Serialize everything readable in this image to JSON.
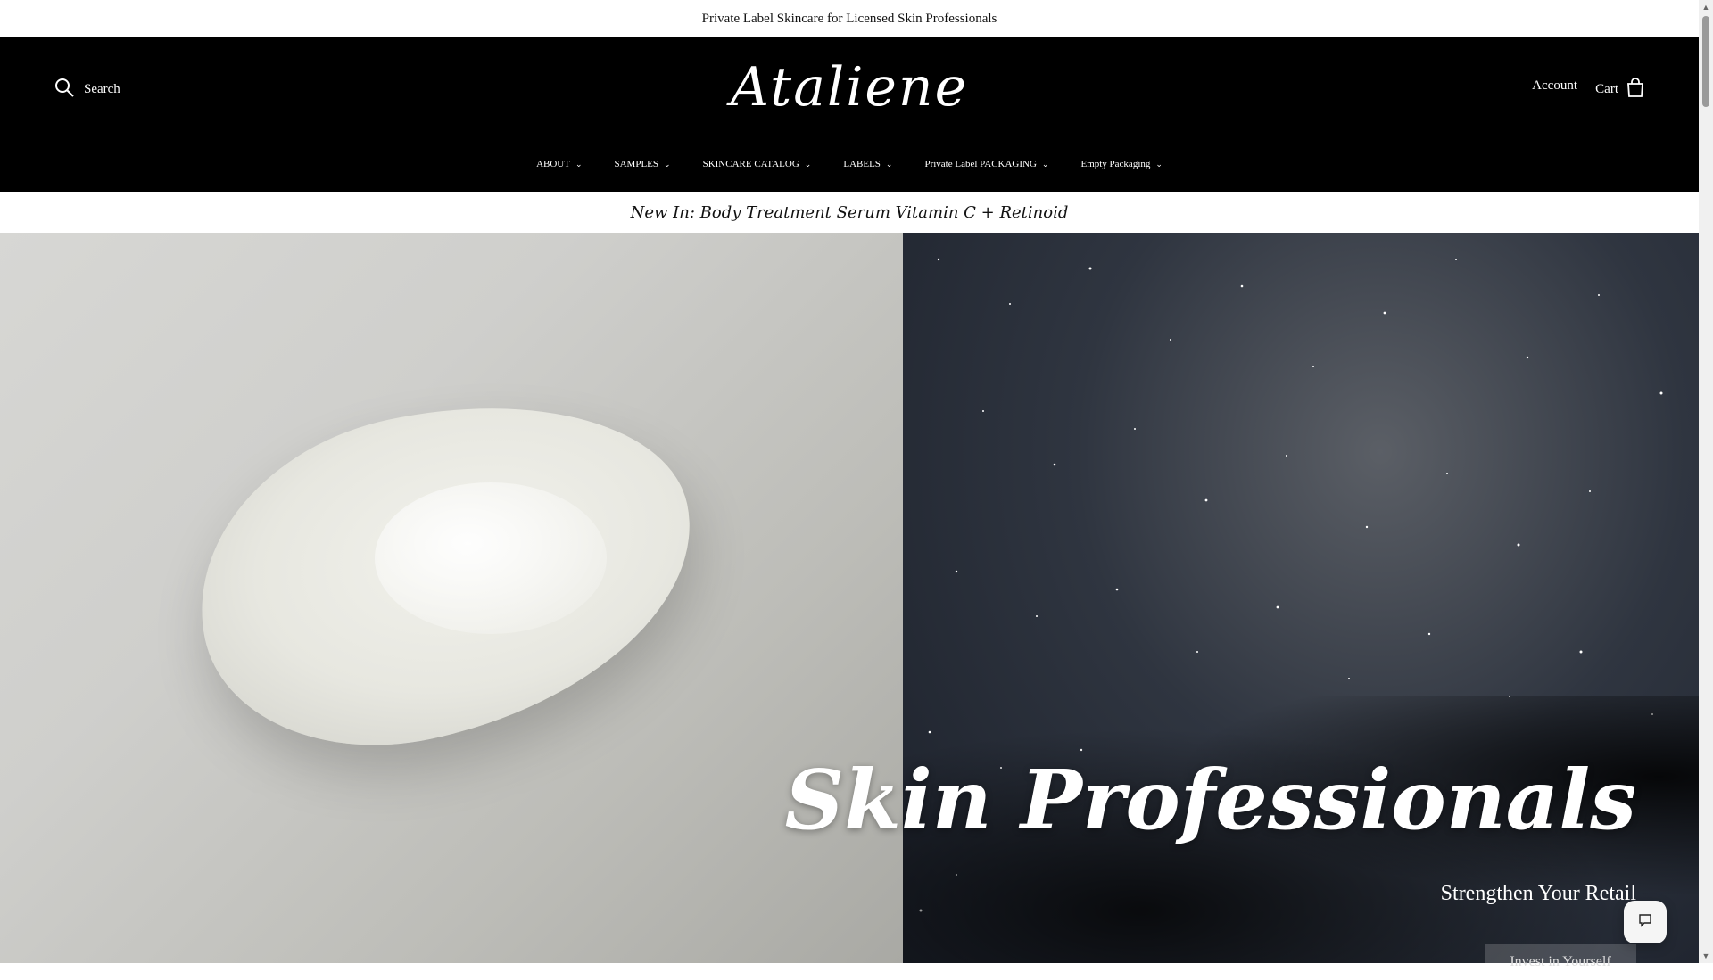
{
  "announcement": "Private Label Skincare for Licensed Skin Professionals",
  "header": {
    "search_label": "Search",
    "logo_text": "Ataliene",
    "account_label": "Account",
    "cart_label": "Cart"
  },
  "nav": {
    "items": [
      {
        "label": "ABOUT"
      },
      {
        "label": "SAMPLES"
      },
      {
        "label": "SKINCARE CATALOG"
      },
      {
        "label": "LABELS"
      },
      {
        "label": "Private Label PACKAGING"
      },
      {
        "label": "Empty Packaging"
      }
    ]
  },
  "promo": "New In: Body Treatment Serum Vitamin C + Retinoid",
  "hero": {
    "title": "Skin Professionals",
    "subtitle": "Strengthen Your Retail",
    "button_label": "Invest in Yourself"
  },
  "colors": {
    "header_bg": "#000000",
    "page_bg": "#ffffff"
  },
  "icons": {
    "search": "search-icon",
    "cart": "bag-icon",
    "chat": "chat-icon"
  }
}
